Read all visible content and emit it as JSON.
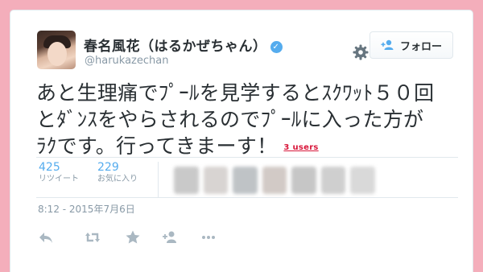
{
  "tweet": {
    "author_name": "春名風花（はるかぜちゃん）",
    "handle": "@harukazechan",
    "follow_label": "フォロー",
    "text_lines": [
      "あと生理痛でﾌﾟｰﾙを見学するとｽｸﾜｯﾄ５０回",
      "とﾀﾞﾝｽをやらされるのでﾌﾟｰﾙに入った方が",
      "ﾗｸです。行ってきまーす！"
    ],
    "users_badge": "3 users",
    "retweets": {
      "count": "425",
      "label": "リツイート"
    },
    "likes": {
      "count": "229",
      "label": "お気に入り"
    },
    "timestamp": "8:12 - 2015年7月6日"
  },
  "colors": {
    "background": "#f4aebb",
    "accent": "#55acee",
    "text": "#292f33",
    "muted": "#8899a6",
    "badge": "#d8163a"
  },
  "icons": {
    "verified": "verified-badge-icon",
    "gear": "gear-icon",
    "follow": "add-user-icon",
    "actions": [
      "reply-icon",
      "retweet-icon",
      "favorite-star-icon",
      "add-user-icon",
      "more-icon"
    ]
  }
}
